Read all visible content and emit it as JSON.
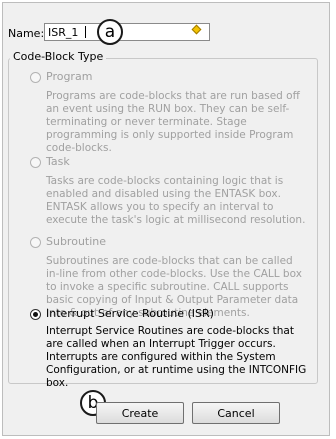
{
  "name_field": {
    "label": "Name:",
    "value": "ISR_1"
  },
  "annotations": {
    "a": "a",
    "b": "b"
  },
  "group": {
    "title": "Code-Block Type",
    "options": [
      {
        "label": "Program",
        "enabled": false,
        "selected": false,
        "description": "Programs are code-blocks that are run based off an event using the RUN box. They can be self-terminating or never terminate.  Stage programming is only supported inside Program code-blocks."
      },
      {
        "label": "Task",
        "enabled": false,
        "selected": false,
        "description": "Tasks are code-blocks containing logic that is enabled and disabled using the ENTASK box. ENTASK allows you to specify an interval to execute the task's logic at millisecond resolution."
      },
      {
        "label": "Subroutine",
        "enabled": false,
        "selected": false,
        "description": "Subroutines are code-blocks that can be called in-line from other code-blocks.  Use the CALL box to invoke a specific subroutine.  CALL supports basic copying of Input & Output Parameter data into & out-of any subroutine elements."
      },
      {
        "label": "Interrupt Service Routine (ISR)",
        "enabled": true,
        "selected": true,
        "description": "Interrupt Service Routines are code-blocks that are called when an Interrupt Trigger occurs.  Interrupts are configured within the System Configuration, or at runtime using the INTCONFIG box."
      }
    ]
  },
  "buttons": {
    "create": "Create",
    "cancel": "Cancel"
  }
}
